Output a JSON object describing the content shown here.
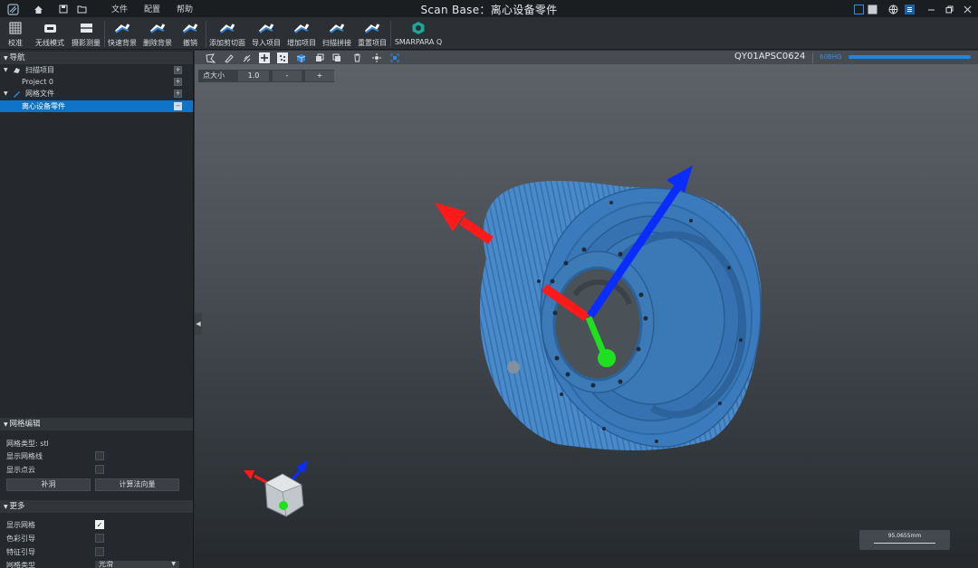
{
  "titlebar": {
    "title": "Scan Base：离心设备零件",
    "menus": [
      "文件",
      "配置",
      "帮助"
    ]
  },
  "toolbar": {
    "items": [
      {
        "label": "校准",
        "icon": "calibration-grid-icon"
      },
      {
        "label": "无线模式",
        "icon": "wireless-scanner-icon"
      },
      {
        "label": "摄影测量",
        "icon": "photogrammetry-icon"
      },
      {
        "label": "快速背景",
        "icon": "quick-background-icon"
      },
      {
        "label": "删除背景",
        "icon": "delete-background-icon"
      },
      {
        "label": "撤销",
        "icon": "undo-icon"
      },
      {
        "label": "添加剪切面",
        "icon": "add-clip-plane-icon"
      },
      {
        "label": "导入项目",
        "icon": "import-project-icon"
      },
      {
        "label": "增加项目",
        "icon": "add-project-icon"
      },
      {
        "label": "扫描拼接",
        "icon": "scan-stitch-icon"
      },
      {
        "label": "重置项目",
        "icon": "reset-project-icon"
      },
      {
        "label": "SMARPARA Q",
        "icon": "smarpara-logo-icon"
      }
    ]
  },
  "nav": {
    "header": "导航",
    "scan_projects": "扫描项目",
    "project0": "Project 0",
    "mesh_files": "网格文件",
    "selected_item": "离心设备零件"
  },
  "mesh_edit": {
    "header": "网格编辑",
    "mesh_type": "网格类型: stl",
    "show_wireframe": "显示网格线",
    "show_point_cloud": "显示点云",
    "fill_holes": "补洞",
    "compute_normals": "计算法向量"
  },
  "more": {
    "header": "更多",
    "show_mesh": "显示网格",
    "color_guide": "色彩引导",
    "feature_guide": "特征引导",
    "mesh_type_label": "网格类型",
    "mesh_type_value": "光滑"
  },
  "viewport": {
    "device_id": "QY01APSC0624",
    "device_status": "60BHG",
    "point_size_label": "点大小",
    "point_size_value": "1.0",
    "minus": "-",
    "plus": "+",
    "scale_value": "95.0655mm"
  },
  "colors": {
    "accent": "#0d74c9",
    "part_blue": "#3f7fc1",
    "axis_red": "#ff1a1a",
    "axis_green": "#1fe01f",
    "axis_blue": "#0a2cff"
  }
}
